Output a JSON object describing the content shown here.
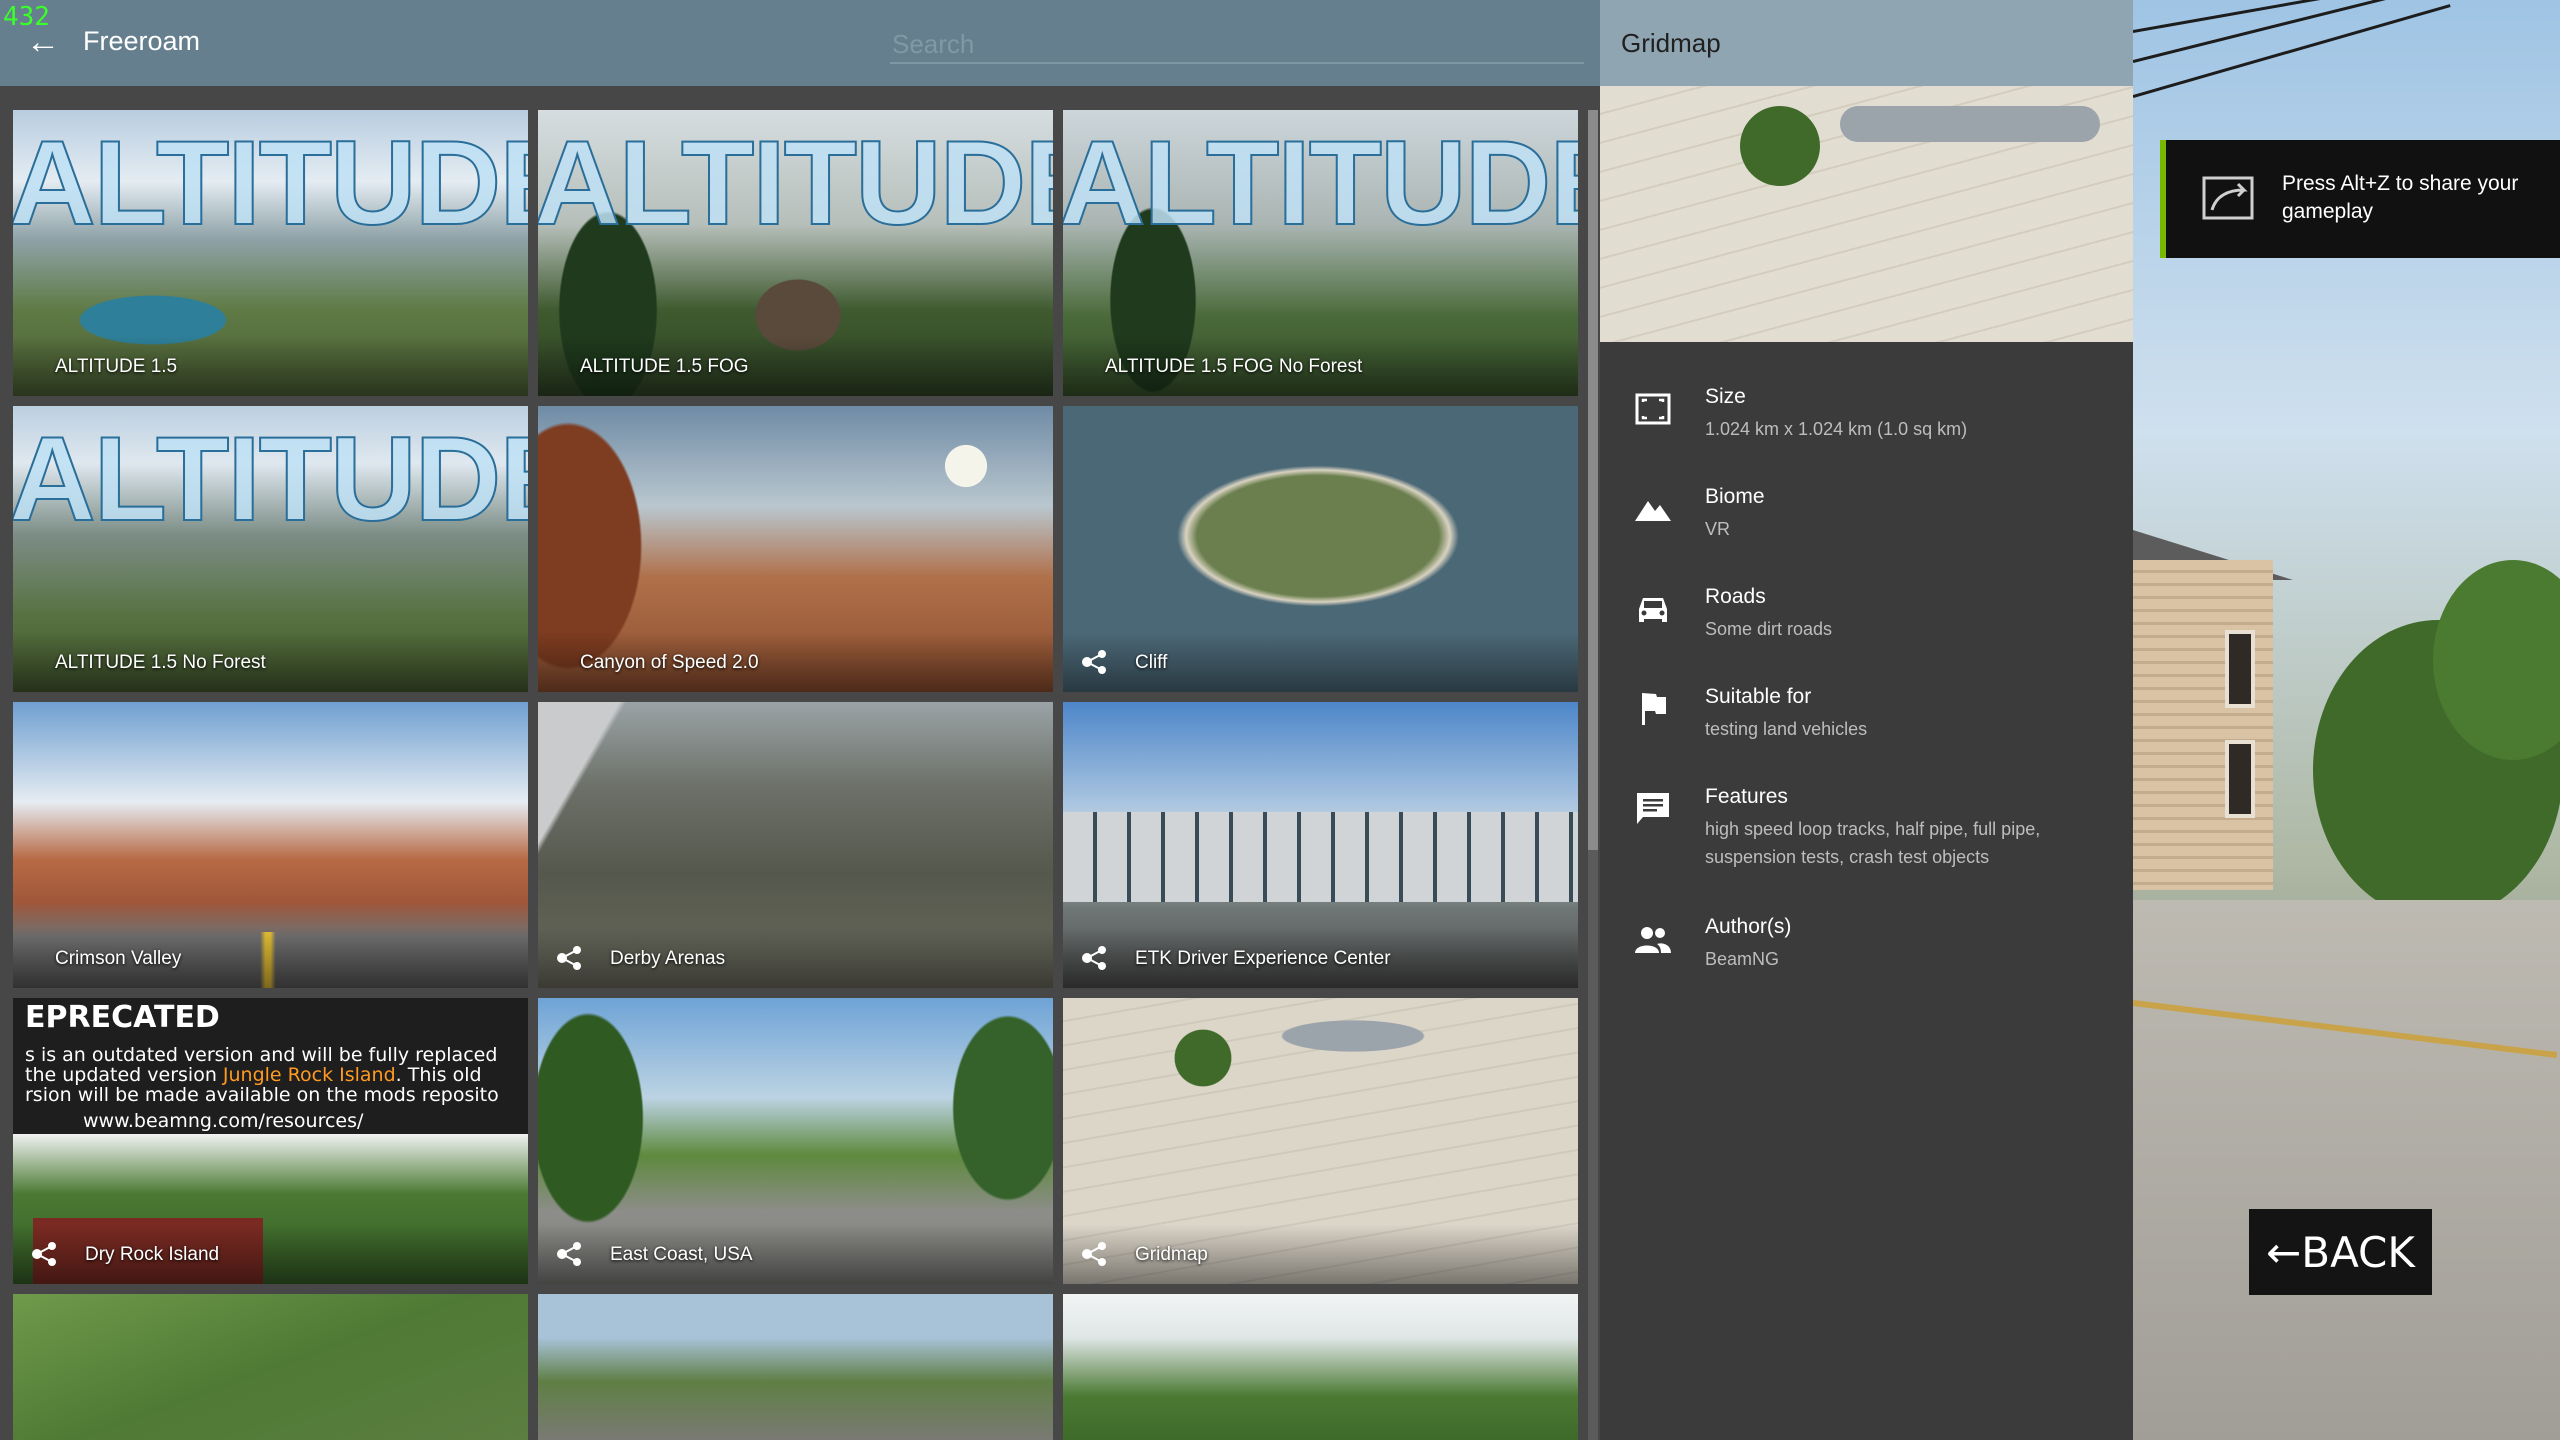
{
  "fps_counter": "432",
  "header": {
    "title": "Freeroam",
    "search_placeholder": "Search"
  },
  "levels": [
    {
      "name": "ALTITUDE 1.5",
      "banner": "ALTITUDE",
      "mod": false
    },
    {
      "name": "ALTITUDE 1.5 FOG",
      "banner": "ALTITUDE",
      "mod": false
    },
    {
      "name": "ALTITUDE 1.5 FOG No Forest",
      "banner": "ALTITUDE",
      "mod": false
    },
    {
      "name": "ALTITUDE 1.5 No Forest",
      "banner": "ALTITUDE",
      "mod": false
    },
    {
      "name": "Canyon of Speed 2.0",
      "mod": false
    },
    {
      "name": "Cliff",
      "mod": true
    },
    {
      "name": "Crimson Valley",
      "mod": false
    },
    {
      "name": "Derby Arenas",
      "mod": true
    },
    {
      "name": "ETK Driver Experience Center",
      "mod": true
    },
    {
      "name": "Dry Rock Island",
      "mod": true
    },
    {
      "name": "East Coast, USA",
      "mod": true
    },
    {
      "name": "Gridmap",
      "mod": true
    }
  ],
  "deprecated": {
    "heading": "EPRECATED",
    "line1": "s is an outdated version and will be fully replaced",
    "line2a": "the updated version ",
    "line2b": "Jungle Rock Island",
    "line2c": ". This old",
    "line3": "rsion will be made available on the mods reposito",
    "url": "www.beamng.com/resources/"
  },
  "panel": {
    "title": "Gridmap",
    "rows": [
      {
        "label": "Size",
        "value": "1.024 km x 1.024 km (1.0 sq km)",
        "icon": "size-icon"
      },
      {
        "label": "Biome",
        "value": "VR",
        "icon": "mountain-icon"
      },
      {
        "label": "Roads",
        "value": "Some dirt roads",
        "icon": "car-icon"
      },
      {
        "label": "Suitable for",
        "value": "testing land vehicles",
        "icon": "flag-icon"
      },
      {
        "label": "Features",
        "value": "high speed loop tracks, half pipe, full pipe, suspension tests, crash test objects",
        "icon": "chat-icon"
      },
      {
        "label": "Author(s)",
        "value": "BeamNG",
        "icon": "people-icon"
      }
    ]
  },
  "share": {
    "text": "Press Alt+Z to share your gameplay"
  },
  "back_button": "←BACK"
}
